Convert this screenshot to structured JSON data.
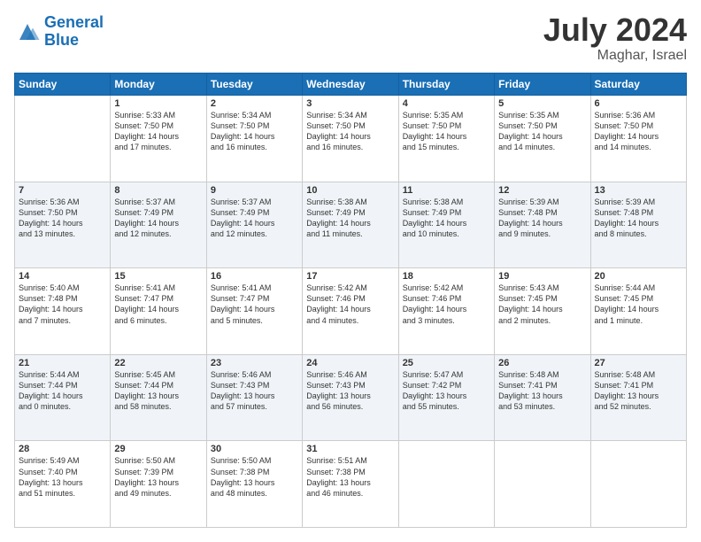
{
  "header": {
    "logo_line1": "General",
    "logo_line2": "Blue",
    "month": "July 2024",
    "location": "Maghar, Israel"
  },
  "days_of_week": [
    "Sunday",
    "Monday",
    "Tuesday",
    "Wednesday",
    "Thursday",
    "Friday",
    "Saturday"
  ],
  "weeks": [
    [
      {
        "num": "",
        "info": ""
      },
      {
        "num": "1",
        "info": "Sunrise: 5:33 AM\nSunset: 7:50 PM\nDaylight: 14 hours\nand 17 minutes."
      },
      {
        "num": "2",
        "info": "Sunrise: 5:34 AM\nSunset: 7:50 PM\nDaylight: 14 hours\nand 16 minutes."
      },
      {
        "num": "3",
        "info": "Sunrise: 5:34 AM\nSunset: 7:50 PM\nDaylight: 14 hours\nand 16 minutes."
      },
      {
        "num": "4",
        "info": "Sunrise: 5:35 AM\nSunset: 7:50 PM\nDaylight: 14 hours\nand 15 minutes."
      },
      {
        "num": "5",
        "info": "Sunrise: 5:35 AM\nSunset: 7:50 PM\nDaylight: 14 hours\nand 14 minutes."
      },
      {
        "num": "6",
        "info": "Sunrise: 5:36 AM\nSunset: 7:50 PM\nDaylight: 14 hours\nand 14 minutes."
      }
    ],
    [
      {
        "num": "7",
        "info": "Sunrise: 5:36 AM\nSunset: 7:50 PM\nDaylight: 14 hours\nand 13 minutes."
      },
      {
        "num": "8",
        "info": "Sunrise: 5:37 AM\nSunset: 7:49 PM\nDaylight: 14 hours\nand 12 minutes."
      },
      {
        "num": "9",
        "info": "Sunrise: 5:37 AM\nSunset: 7:49 PM\nDaylight: 14 hours\nand 12 minutes."
      },
      {
        "num": "10",
        "info": "Sunrise: 5:38 AM\nSunset: 7:49 PM\nDaylight: 14 hours\nand 11 minutes."
      },
      {
        "num": "11",
        "info": "Sunrise: 5:38 AM\nSunset: 7:49 PM\nDaylight: 14 hours\nand 10 minutes."
      },
      {
        "num": "12",
        "info": "Sunrise: 5:39 AM\nSunset: 7:48 PM\nDaylight: 14 hours\nand 9 minutes."
      },
      {
        "num": "13",
        "info": "Sunrise: 5:39 AM\nSunset: 7:48 PM\nDaylight: 14 hours\nand 8 minutes."
      }
    ],
    [
      {
        "num": "14",
        "info": "Sunrise: 5:40 AM\nSunset: 7:48 PM\nDaylight: 14 hours\nand 7 minutes."
      },
      {
        "num": "15",
        "info": "Sunrise: 5:41 AM\nSunset: 7:47 PM\nDaylight: 14 hours\nand 6 minutes."
      },
      {
        "num": "16",
        "info": "Sunrise: 5:41 AM\nSunset: 7:47 PM\nDaylight: 14 hours\nand 5 minutes."
      },
      {
        "num": "17",
        "info": "Sunrise: 5:42 AM\nSunset: 7:46 PM\nDaylight: 14 hours\nand 4 minutes."
      },
      {
        "num": "18",
        "info": "Sunrise: 5:42 AM\nSunset: 7:46 PM\nDaylight: 14 hours\nand 3 minutes."
      },
      {
        "num": "19",
        "info": "Sunrise: 5:43 AM\nSunset: 7:45 PM\nDaylight: 14 hours\nand 2 minutes."
      },
      {
        "num": "20",
        "info": "Sunrise: 5:44 AM\nSunset: 7:45 PM\nDaylight: 14 hours\nand 1 minute."
      }
    ],
    [
      {
        "num": "21",
        "info": "Sunrise: 5:44 AM\nSunset: 7:44 PM\nDaylight: 14 hours\nand 0 minutes."
      },
      {
        "num": "22",
        "info": "Sunrise: 5:45 AM\nSunset: 7:44 PM\nDaylight: 13 hours\nand 58 minutes."
      },
      {
        "num": "23",
        "info": "Sunrise: 5:46 AM\nSunset: 7:43 PM\nDaylight: 13 hours\nand 57 minutes."
      },
      {
        "num": "24",
        "info": "Sunrise: 5:46 AM\nSunset: 7:43 PM\nDaylight: 13 hours\nand 56 minutes."
      },
      {
        "num": "25",
        "info": "Sunrise: 5:47 AM\nSunset: 7:42 PM\nDaylight: 13 hours\nand 55 minutes."
      },
      {
        "num": "26",
        "info": "Sunrise: 5:48 AM\nSunset: 7:41 PM\nDaylight: 13 hours\nand 53 minutes."
      },
      {
        "num": "27",
        "info": "Sunrise: 5:48 AM\nSunset: 7:41 PM\nDaylight: 13 hours\nand 52 minutes."
      }
    ],
    [
      {
        "num": "28",
        "info": "Sunrise: 5:49 AM\nSunset: 7:40 PM\nDaylight: 13 hours\nand 51 minutes."
      },
      {
        "num": "29",
        "info": "Sunrise: 5:50 AM\nSunset: 7:39 PM\nDaylight: 13 hours\nand 49 minutes."
      },
      {
        "num": "30",
        "info": "Sunrise: 5:50 AM\nSunset: 7:38 PM\nDaylight: 13 hours\nand 48 minutes."
      },
      {
        "num": "31",
        "info": "Sunrise: 5:51 AM\nSunset: 7:38 PM\nDaylight: 13 hours\nand 46 minutes."
      },
      {
        "num": "",
        "info": ""
      },
      {
        "num": "",
        "info": ""
      },
      {
        "num": "",
        "info": ""
      }
    ]
  ]
}
